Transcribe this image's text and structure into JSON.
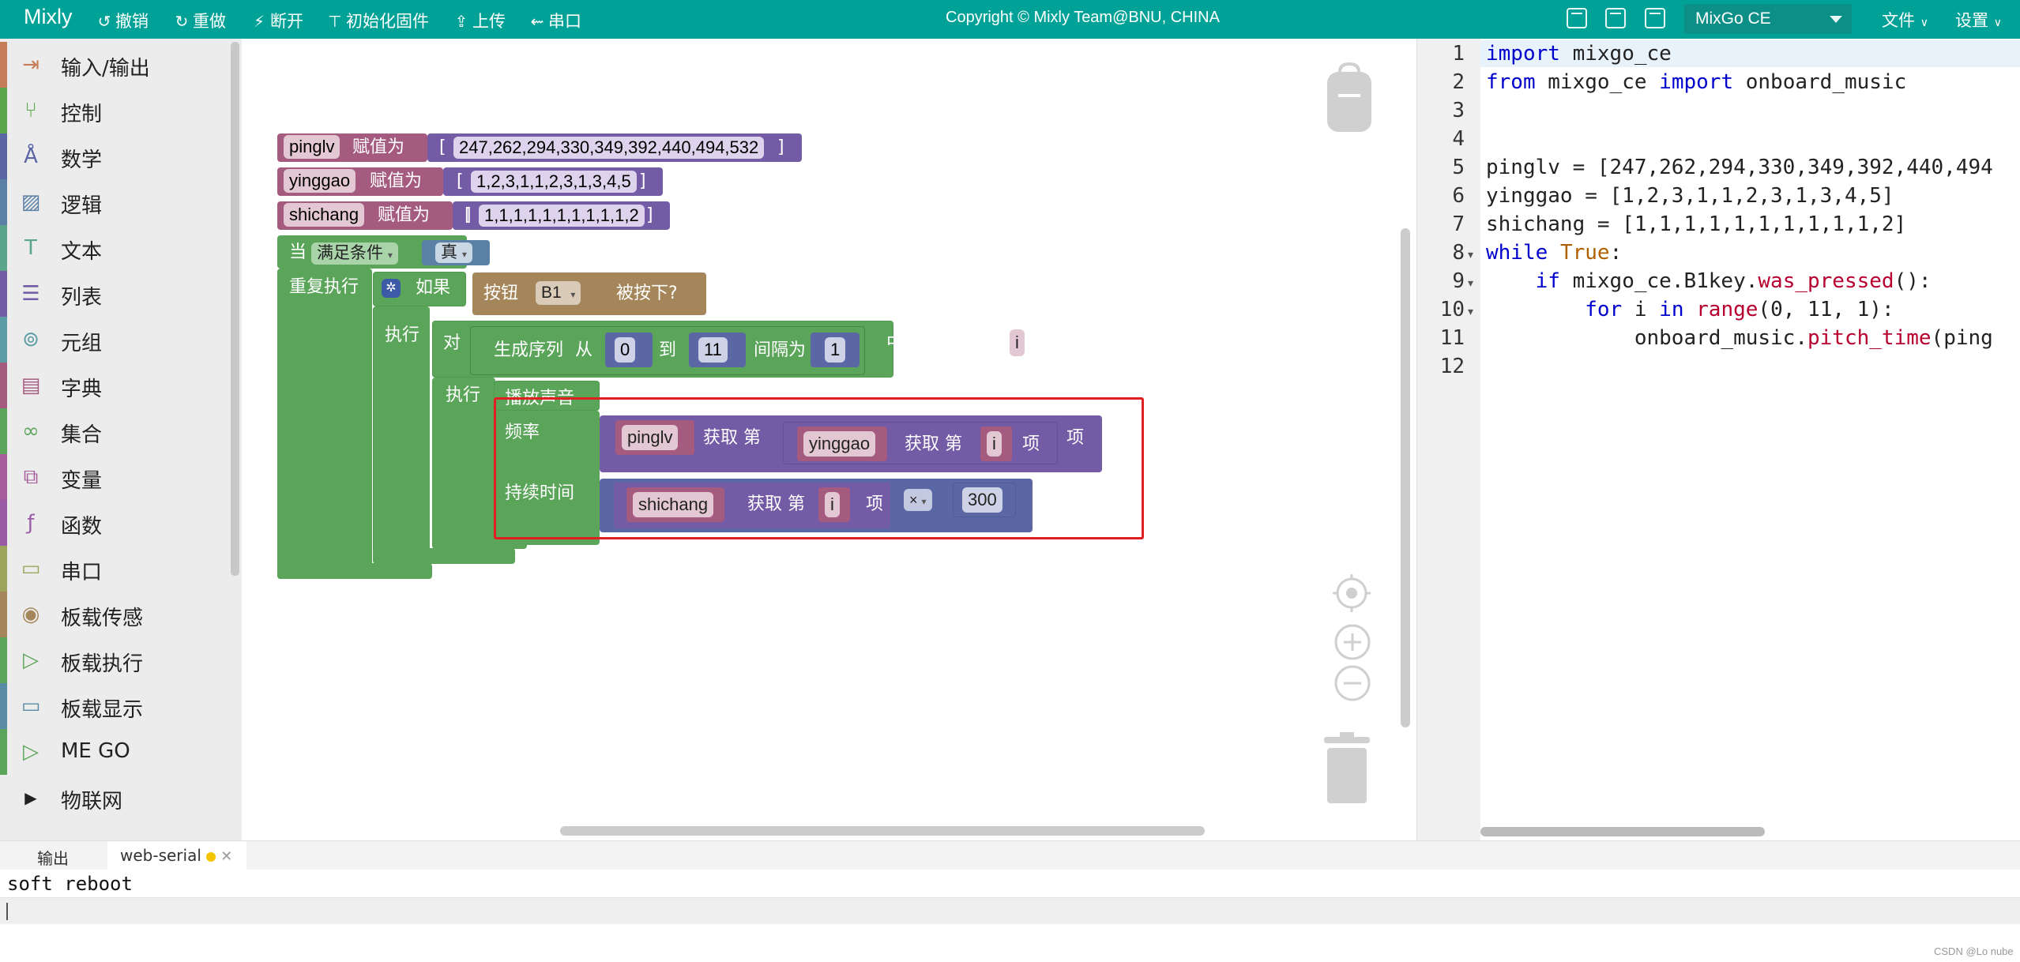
{
  "topbar": {
    "brand": "Mixly",
    "undo": "撤销",
    "redo": "重做",
    "disconnect": "断开",
    "init_firmware": "初始化固件",
    "upload": "上传",
    "serial": "串口",
    "copyright": "Copyright © Mixly Team@BNU, CHINA",
    "board": "MixGo CE",
    "file_menu": "文件",
    "settings_menu": "设置"
  },
  "sidebar": {
    "items": [
      {
        "label": "输入/输出",
        "color": "#c67d5a"
      },
      {
        "label": "控制",
        "color": "#5aa64a"
      },
      {
        "label": "数学",
        "color": "#5b67a5"
      },
      {
        "label": "逻辑",
        "color": "#5b80a5"
      },
      {
        "label": "文本",
        "color": "#5ba58c"
      },
      {
        "label": "列表",
        "color": "#745ba5"
      },
      {
        "label": "元组",
        "color": "#5b9ca5"
      },
      {
        "label": "字典",
        "color": "#a55b80"
      },
      {
        "label": "集合",
        "color": "#5ba55b"
      },
      {
        "label": "变量",
        "color": "#a55b9c"
      },
      {
        "label": "函数",
        "color": "#995ba5"
      },
      {
        "label": "串口",
        "color": "#9ca55b"
      },
      {
        "label": "板载传感",
        "color": "#a5865b"
      },
      {
        "label": "板载执行",
        "color": "#5ba55b"
      },
      {
        "label": "板载显示",
        "color": "#5b8ca5"
      },
      {
        "label": "ME GO",
        "color": "#5ba55b"
      },
      {
        "label": "物联网",
        "color": "#ececec"
      }
    ]
  },
  "blocks": {
    "var1": "pinglv",
    "assign": "赋值为",
    "list1": "247,262,294,330,349,392,440,494,532",
    "var2": "yinggao",
    "list2": "1,2,3,1,1,2,3,1,3,4,5",
    "var3": "shichang",
    "list3": "1,1,1,1,1,1,1,1,1,1,2",
    "lbracket": "[",
    "rbracket": "]",
    "when": "当",
    "while_cond": "满足条件",
    "true_val": "真",
    "repeat": "重复执行",
    "if": "如果",
    "button": "按钮",
    "button_id": "B1",
    "pressed": "被按下?",
    "do": "执行",
    "for": "对",
    "range": "生成序列",
    "from": "从",
    "from_val": "0",
    "to": "到",
    "to_val": "11",
    "step": "间隔为",
    "step_val": "1",
    "each": "中的每个项目",
    "iter_var": "i",
    "play_sound": "播放声音",
    "frequency": "频率",
    "get_item": "获取 第",
    "item": "项",
    "duration": "持续时间",
    "multiply": "×",
    "mult_val": "300"
  },
  "editor": {
    "lines": [
      "import mixgo_ce",
      "from mixgo_ce import onboard_music",
      "",
      "",
      "pinglv = [247,262,294,330,349,392,440,494",
      "yinggao = [1,2,3,1,1,2,3,1,3,4,5]",
      "shichang = [1,1,1,1,1,1,1,1,1,1,2]",
      "while True:",
      "    if mixgo_ce.B1key.was_pressed():",
      "        for i in range(0, 11, 1):",
      "            onboard_music.pitch_time(ping",
      ""
    ]
  },
  "bottom": {
    "tab_output": "输出",
    "tab_serial": "web-serial",
    "console_text": "soft reboot",
    "watermark": "CSDN @Lo nube"
  },
  "colors": {
    "topbar": "#00a297",
    "list_block": "#745ba5",
    "var_block": "#a55b80",
    "control_block": "#5ba55b",
    "sensor_block": "#a5865b"
  }
}
